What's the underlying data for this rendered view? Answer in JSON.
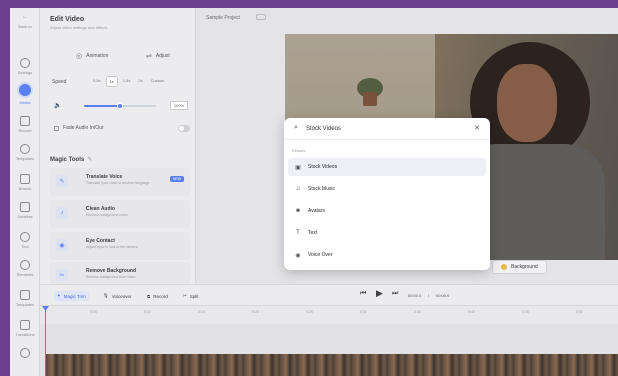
{
  "rail": {
    "items": [
      {
        "label": "Back to"
      },
      {
        "label": "Settings"
      },
      {
        "label": "Media"
      },
      {
        "label": "Record"
      },
      {
        "label": "Templates"
      },
      {
        "label": "Brands"
      },
      {
        "label": "Subtitles"
      },
      {
        "label": "Text"
      },
      {
        "label": "Elements"
      },
      {
        "label": "Templates"
      },
      {
        "label": "Transitions"
      }
    ],
    "active_index": 2
  },
  "panel": {
    "title": "Edit Video",
    "subtitle": "Adjust video settings and effects",
    "tab_animation": "Animation",
    "tab_adjust": "Adjust",
    "speed_label": "Speed",
    "speed_options": [
      "0.5x",
      "1x",
      "1.5x",
      "2x",
      "Custom"
    ],
    "speed_selected_index": 1,
    "volume_value": "100%",
    "volume_level": 0.5,
    "fade_label": "Fade Audio In/Out",
    "magic_title": "Magic Tools",
    "tools": [
      {
        "name": "Translate Voice",
        "desc": "Translate your voice to another language",
        "badge": "NEW"
      },
      {
        "name": "Clean Audio",
        "desc": "Remove background noise"
      },
      {
        "name": "Eye Contact",
        "desc": "Adjust eyes to look at the camera"
      },
      {
        "name": "Remove Background",
        "desc": "Remove background from video"
      }
    ]
  },
  "project": {
    "name": "Sample Project"
  },
  "popup": {
    "query": "Stock Videos",
    "results_label": "Results",
    "items": [
      {
        "icon": "film-icon",
        "glyph": "▣",
        "label": "Stock Videos"
      },
      {
        "icon": "music-icon",
        "glyph": "♫",
        "label": "Stock Music"
      },
      {
        "icon": "avatars-icon",
        "glyph": "☻",
        "label": "Avatars"
      },
      {
        "icon": "text-icon",
        "glyph": "T",
        "label": "Text"
      },
      {
        "icon": "voice-icon",
        "glyph": "◉",
        "label": "Voice Over"
      }
    ],
    "highlight_index": 0
  },
  "background_button": "Background",
  "timeline": {
    "magic_label": "Magic Trim",
    "voiceover_label": "Voiceover",
    "record_label": "Record",
    "split_label": "Split",
    "current_time": "00:00.0",
    "total_time": "00:00.0",
    "ticks": [
      "0:05",
      "0:10",
      "0:15",
      "0:20",
      "0:25",
      "0:30",
      "0:35",
      "0:40",
      "0:45",
      "0:50"
    ]
  },
  "colors": {
    "accent": "#5b7ff0",
    "frame_border": "#6b3f8e"
  }
}
